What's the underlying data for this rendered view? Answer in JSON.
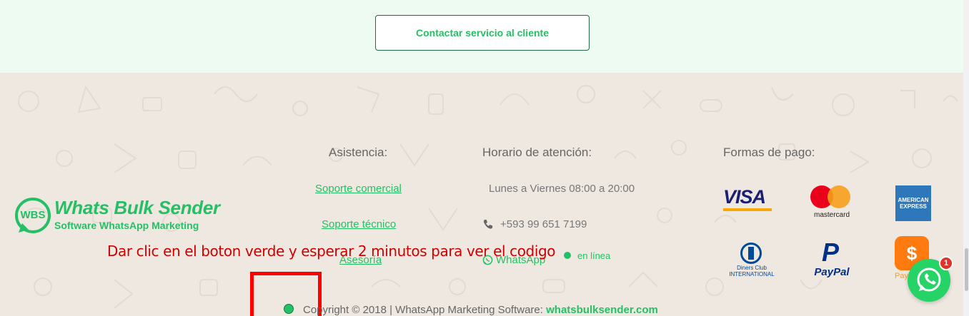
{
  "cta": {
    "label": "Contactar servicio al cliente"
  },
  "footer": {
    "asistencia": {
      "heading": "Asistencia:",
      "links": [
        "Soporte comercial",
        "Soporte técnico",
        "Asesoría"
      ]
    },
    "horario": {
      "heading": "Horario de atención:",
      "hours": "Lunes a Viernes 08:00 a 20:00",
      "phone": "+593 99 651 7199",
      "whatsapp": "WhatsApp",
      "online": "en línea"
    },
    "pago": {
      "heading": "Formas de pago:",
      "methods": [
        "VISA",
        "mastercard",
        "AMERICAN EXPRESS",
        "Diners Club INTERNATIONAL",
        "PayPal",
        "PayPhone"
      ]
    },
    "logo": {
      "badge": "WBS",
      "title": "Whats Bulk Sender",
      "subtitle": "Software WhatsApp Marketing"
    },
    "copyright": {
      "text": "Copyright © 2018 | WhatsApp Marketing Software:",
      "site": "whatsbulksender.com"
    }
  },
  "overlay": {
    "instruction": "Dar clic en el boton verde y esperar 2 minutos para ver el codigo"
  },
  "floating": {
    "badge_count": "1"
  },
  "colors": {
    "brand_green": "#25c065",
    "overlay_red": "#d00000",
    "band": "#edfbf3",
    "footer_bg": "#efe8e1"
  }
}
